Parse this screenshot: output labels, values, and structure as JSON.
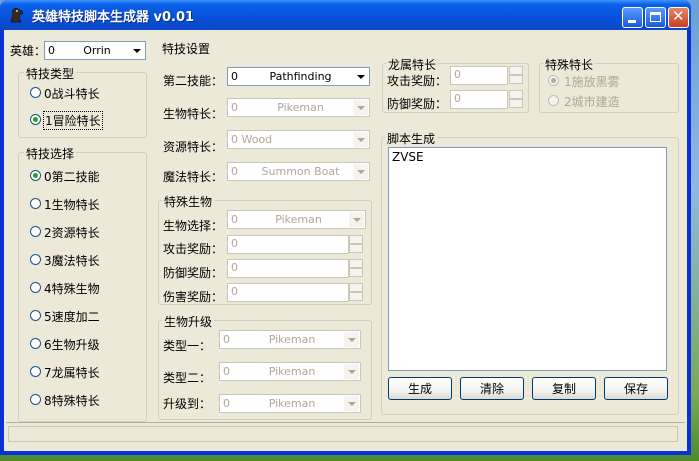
{
  "window": {
    "title": "英雄特技脚本生成器 v0.01"
  },
  "hero": {
    "label": "英雄：",
    "value": "0",
    "name": "Orrin"
  },
  "specialty_type": {
    "label": "特技类型",
    "options": [
      "0战斗特长",
      "1冒险特长"
    ],
    "selected_index": 1
  },
  "specialty_select": {
    "label": "特技选择",
    "options": [
      "0第二技能",
      "1生物特长",
      "2资源特长",
      "3魔法特长",
      "4特殊生物",
      "5速度加二",
      "6生物升级",
      "7龙属特长",
      "8特殊特长"
    ],
    "selected_index": 0
  },
  "settings": {
    "label": "特技设置",
    "secondary_skill": {
      "label": "第二技能：",
      "value": "0",
      "name": "Pathfinding"
    },
    "creature_specialty": {
      "label": "生物特长：",
      "value": "0",
      "name": "Pikeman"
    },
    "resource_specialty": {
      "label": "资源特长：",
      "value": "0 Wood"
    },
    "magic_specialty": {
      "label": "魔法特长：",
      "value": "0",
      "name": "Summon Boat"
    }
  },
  "special_creature": {
    "label": "特殊生物",
    "creature_select": {
      "label": "生物选择：",
      "value": "0",
      "name": "Pikeman"
    },
    "attack_bonus": {
      "label": "攻击奖励：",
      "value": "0"
    },
    "defense_bonus": {
      "label": "防御奖励：",
      "value": "0"
    },
    "damage_bonus": {
      "label": "伤害奖励：",
      "value": "0"
    }
  },
  "creature_upgrade": {
    "label": "生物升级",
    "type_one": {
      "label": "类型一：",
      "value": "0",
      "name": "Pikeman"
    },
    "type_two": {
      "label": "类型二：",
      "value": "0",
      "name": "Pikeman"
    },
    "upgrade_to": {
      "label": "升级到：",
      "value": "0",
      "name": "Pikeman"
    }
  },
  "dragon_specialty": {
    "label": "龙属特长",
    "attack_bonus": {
      "label": "攻击奖励：",
      "value": "0"
    },
    "defense_bonus": {
      "label": "防御奖励：",
      "value": "0"
    }
  },
  "special_specialty": {
    "label": "特殊特长",
    "options": [
      "1施放黑雾",
      "2城市建造"
    ],
    "selected_index": 0
  },
  "script": {
    "label": "脚本生成",
    "text": "ZVSE",
    "buttons": {
      "generate": "生成",
      "clear": "清除",
      "copy": "复制",
      "save": "保存"
    }
  },
  "colors": {
    "titlebar": "#0a5fe8",
    "client_bg": "#ece9d8",
    "radio_selected": "#21a121"
  }
}
